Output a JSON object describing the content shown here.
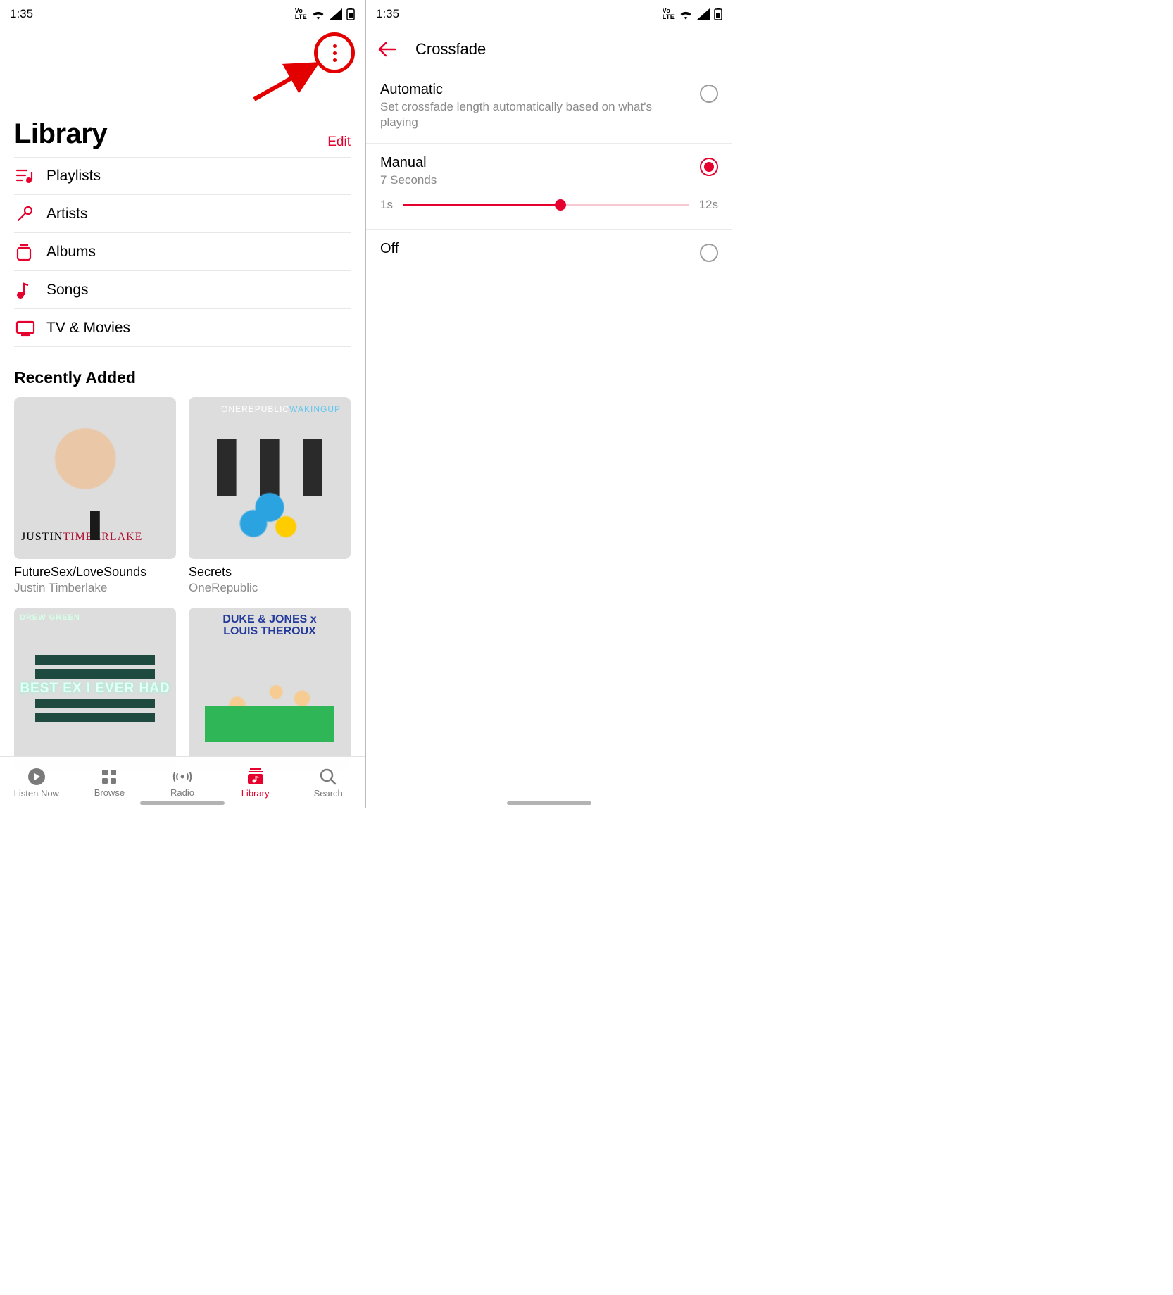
{
  "status": {
    "time": "1:35",
    "volte_top": "Vo",
    "volte_bot": "LTE"
  },
  "left": {
    "page_title": "Library",
    "edit_label": "Edit",
    "categories": [
      {
        "icon": "playlist",
        "label": "Playlists"
      },
      {
        "icon": "mic",
        "label": "Artists"
      },
      {
        "icon": "album",
        "label": "Albums"
      },
      {
        "icon": "note",
        "label": "Songs"
      },
      {
        "icon": "tv",
        "label": "TV & Movies"
      }
    ],
    "recently_added_title": "Recently Added",
    "albums": [
      {
        "title": "FutureSex/LoveSounds",
        "artist": "Justin Timberlake",
        "cover_text1": "JUSTIN",
        "cover_text2": "TIMBERLAKE"
      },
      {
        "title": "Secrets",
        "artist": "OneRepublic",
        "cover_text1": "ONEREPUBLIC",
        "cover_text2": "WAKINGUP"
      },
      {
        "title": "",
        "artist": "",
        "cover_brand": "DREW GREEN",
        "cover_line": "BEST EX I EVER HAD"
      },
      {
        "title": "",
        "artist": "",
        "cover_line1": "DUKE & JONES x",
        "cover_line2": "LOUIS THEROUX"
      }
    ],
    "tabs": [
      {
        "label": "Listen Now",
        "icon": "play-circle"
      },
      {
        "label": "Browse",
        "icon": "grid"
      },
      {
        "label": "Radio",
        "icon": "radio"
      },
      {
        "label": "Library",
        "icon": "library",
        "active": true
      },
      {
        "label": "Search",
        "icon": "search"
      }
    ]
  },
  "right": {
    "settings_title": "Crossfade",
    "options": [
      {
        "title": "Automatic",
        "subtitle": "Set crossfade length automatically based on what's playing",
        "selected": false
      },
      {
        "title": "Manual",
        "subtitle": "7 Seconds",
        "selected": true
      },
      {
        "title": "Off",
        "subtitle": "",
        "selected": false
      }
    ],
    "slider": {
      "min_label": "1s",
      "max_label": "12s",
      "min": 1,
      "max": 12,
      "value": 7
    }
  }
}
